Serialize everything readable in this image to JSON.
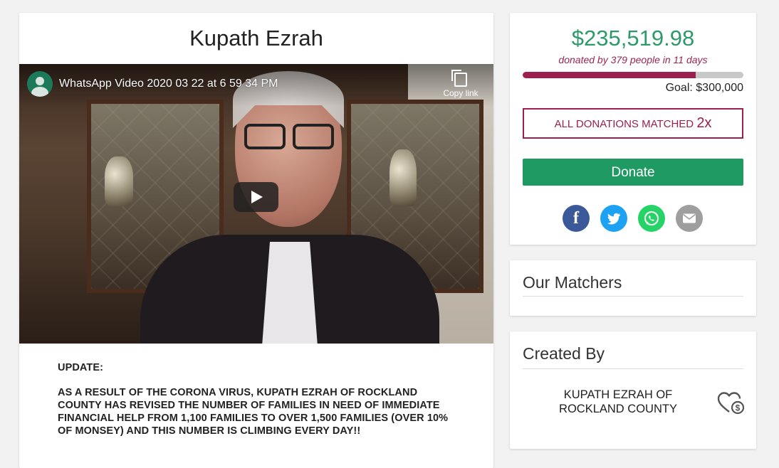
{
  "campaign": {
    "title": "Kupath Ezrah",
    "video": {
      "title": "WhatsApp Video 2020 03 22 at 6 59 34 PM",
      "copy_link_label": "Copy link"
    },
    "description": [
      "UPDATE:",
      "AS A RESULT OF THE CORONA VIRUS, KUPATH EZRAH OF ROCKLAND COUNTY HAS REVISED THE NUMBER OF FAMILIES IN NEED OF IMMEDIATE FINANCIAL HELP FROM 1,100 FAMILIES TO OVER 1,500 FAMILIES (OVER 10% OF MONSEY) AND THIS NUMBER IS CLIMBING EVERY DAY!!"
    ]
  },
  "donation": {
    "amount_raised": "$235,519.98",
    "donated_by": "donated by 379 people in 11 days",
    "goal_label": "Goal: $300,000",
    "progress_fraction": 0.785,
    "matched_label": "ALL DONATIONS MATCHED ",
    "matched_multiplier": "2x",
    "donate_label": "Donate",
    "share": [
      "facebook-icon",
      "twitter-icon",
      "whatsapp-icon",
      "email-icon"
    ]
  },
  "matchers": {
    "heading": "Our Matchers"
  },
  "creator": {
    "heading": "Created By",
    "name": "KUPATH EZRAH OF ROCKLAND COUNTY",
    "icon": "charity-heart-icon"
  },
  "colors": {
    "accent_green": "#2e9a6a",
    "button_green": "#1f9a63",
    "accent_maroon": "#9b1f4f"
  }
}
